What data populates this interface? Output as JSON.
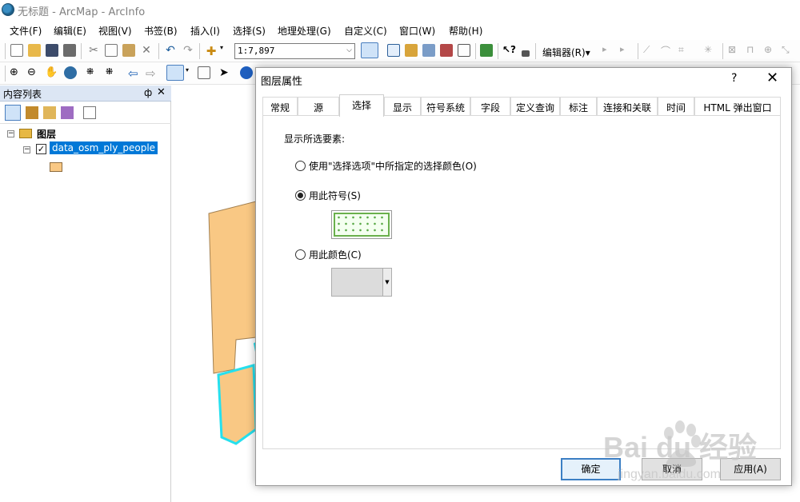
{
  "window": {
    "title": "无标题 - ArcMap - ArcInfo"
  },
  "menu": [
    "文件(F)",
    "编辑(E)",
    "视图(V)",
    "书签(B)",
    "插入(I)",
    "选择(S)",
    "地理处理(G)",
    "自定义(C)",
    "窗口(W)",
    "帮助(H)"
  ],
  "toolbar": {
    "scale": "1:7,897",
    "editor_label": "编辑器(R)▾"
  },
  "toc": {
    "title": "内容列表",
    "pin": "ф",
    "close": "✕",
    "root_layer": "图层",
    "layer_name": "data_osm_ply_people",
    "layer_checked": true,
    "layer_fill_color": "#f9c884"
  },
  "dialog": {
    "title": "图层属性",
    "help": "?",
    "close": "✕",
    "tabs": [
      "常规",
      "源",
      "选择",
      "显示",
      "符号系统",
      "字段",
      "定义查询",
      "标注",
      "连接和关联",
      "时间",
      "HTML 弹出窗口"
    ],
    "active_tab": "选择",
    "section_label": "显示所选要素:",
    "options": [
      {
        "label": "使用\"选择选项\"中所指定的选择颜色(O)",
        "selected": false
      },
      {
        "label": "用此符号(S)",
        "selected": true
      },
      {
        "label": "用此颜色(C)",
        "selected": false
      }
    ],
    "buttons": {
      "ok": "确定",
      "cancel": "取消",
      "apply": "应用(A)"
    }
  },
  "colors": {
    "selection_outline": "#26e0ee",
    "polygon_fill": "#f9c884",
    "toc_header": "#dce6f4",
    "highlight": "#0078d7"
  },
  "watermark": {
    "brand": "Bai du 经验",
    "url": "jingyan.baidu.com"
  }
}
